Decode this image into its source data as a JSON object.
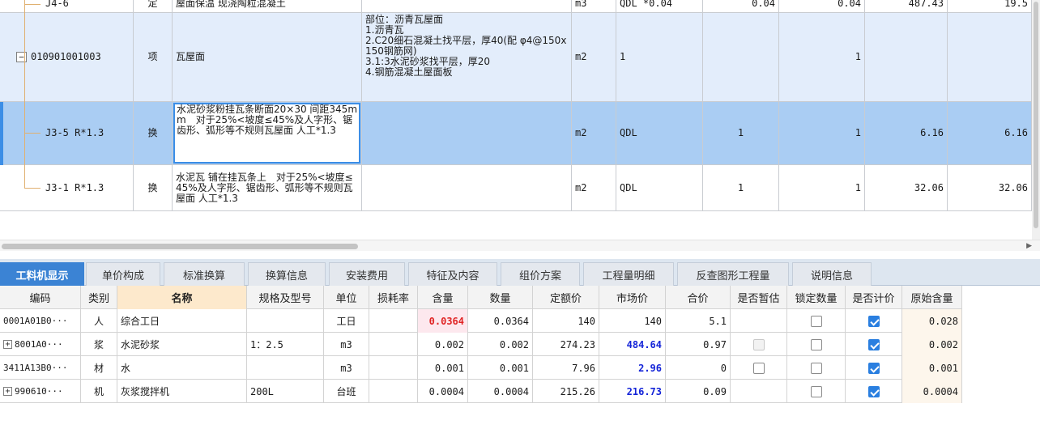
{
  "upper": {
    "rows": [
      {
        "code": "J4-6",
        "type": "定",
        "name": "屋面保温 现浇陶粒混凝土",
        "feature": "",
        "unit": "m3",
        "expr": "QDL *0.04",
        "qty": "0.04",
        "qty2": "0.04",
        "price": "487.43",
        "total": "19.5"
      },
      {
        "code": "010901001003",
        "type": "项",
        "name": "瓦屋面",
        "feature": "部位：沥青瓦屋面\n1.沥青瓦\n2.C20细石混凝土找平层，厚40(配 φ4@150x150钢筋网)\n3.1:3水泥砂浆找平层，厚20\n4.钢筋混凝土屋面板",
        "unit": "m2",
        "expr": "1",
        "qty": "",
        "qty2": "1",
        "price": "",
        "total": ""
      },
      {
        "code": "J3-5 R*1.3",
        "type": "换",
        "name": "水泥砂浆粉挂瓦条断面20×30 间距345mm　对于25%<坡度≤45%及人字形、锯齿形、弧形等不规则瓦屋面 人工*1.3",
        "feature": "",
        "unit": "m2",
        "expr": "QDL",
        "qty": "1",
        "qty2": "1",
        "price": "6.16",
        "total": "6.16"
      },
      {
        "code": "J3-1 R*1.3",
        "type": "换",
        "name": "水泥瓦 铺在挂瓦条上　对于25%<坡度≤45%及人字形、锯齿形、弧形等不规则瓦屋面 人工*1.3",
        "feature": "",
        "unit": "m2",
        "expr": "QDL",
        "qty": "1",
        "qty2": "1",
        "price": "32.06",
        "total": "32.06"
      }
    ],
    "expander_symbol": "−"
  },
  "tabs": [
    {
      "label": "工料机显示",
      "active": true
    },
    {
      "label": "单价构成",
      "active": false
    },
    {
      "label": "标准换算",
      "active": false
    },
    {
      "label": "换算信息",
      "active": false
    },
    {
      "label": "安装费用",
      "active": false
    },
    {
      "label": "特征及内容",
      "active": false
    },
    {
      "label": "组价方案",
      "active": false
    },
    {
      "label": "工程量明细",
      "active": false
    },
    {
      "label": "反查图形工程量",
      "active": false
    },
    {
      "label": "说明信息",
      "active": false
    }
  ],
  "lower": {
    "headers": [
      "编码",
      "类别",
      "名称",
      "规格及型号",
      "单位",
      "损耗率",
      "含量",
      "数量",
      "定额价",
      "市场价",
      "合价",
      "是否暂估",
      "锁定数量",
      "是否计价",
      "原始含量"
    ],
    "rows": [
      {
        "code": "0001A01B0···",
        "plus": false,
        "category": "人",
        "name": "综合工日",
        "spec": "",
        "unit": "工日",
        "loss": "",
        "content": "0.0364",
        "qty": "0.0364",
        "quota_price": "140",
        "market_price": "140",
        "total": "5.1",
        "provisional": "none",
        "locked": "off",
        "priced": "on",
        "orig": "0.028"
      },
      {
        "code": "8001A0···",
        "plus": true,
        "category": "浆",
        "name": "水泥砂浆",
        "spec": "1：2.5",
        "unit": "m3",
        "loss": "",
        "content": "0.002",
        "qty": "0.002",
        "quota_price": "274.23",
        "market_price": "484.64",
        "total": "0.97",
        "provisional": "disabled",
        "locked": "off",
        "priced": "on",
        "orig": "0.002"
      },
      {
        "code": "3411A13B0···",
        "plus": false,
        "category": "材",
        "name": "水",
        "spec": "",
        "unit": "m3",
        "loss": "",
        "content": "0.001",
        "qty": "0.001",
        "quota_price": "7.96",
        "market_price": "2.96",
        "total": "0",
        "provisional": "off",
        "locked": "off",
        "priced": "on",
        "orig": "0.001"
      },
      {
        "code": "990610···",
        "plus": true,
        "category": "机",
        "name": "灰浆搅拌机",
        "spec": "200L",
        "unit": "台班",
        "loss": "",
        "content": "0.0004",
        "qty": "0.0004",
        "quota_price": "215.26",
        "market_price": "216.73",
        "total": "0.09",
        "provisional": "none",
        "locked": "off",
        "priced": "on",
        "orig": "0.0004"
      }
    ],
    "plus_symbol": "+"
  },
  "colors": {
    "tab_active": "#3b83d4",
    "row_selected": "#aacdf3",
    "row_item": "#e3edfb",
    "content_highlight": "#e02424",
    "market_price": "#1424d8",
    "checkbox_on": "#2a7fe0"
  },
  "icons": {
    "scroll_right": "chevron-right-icon",
    "scroll_right_glyph": "▶"
  }
}
